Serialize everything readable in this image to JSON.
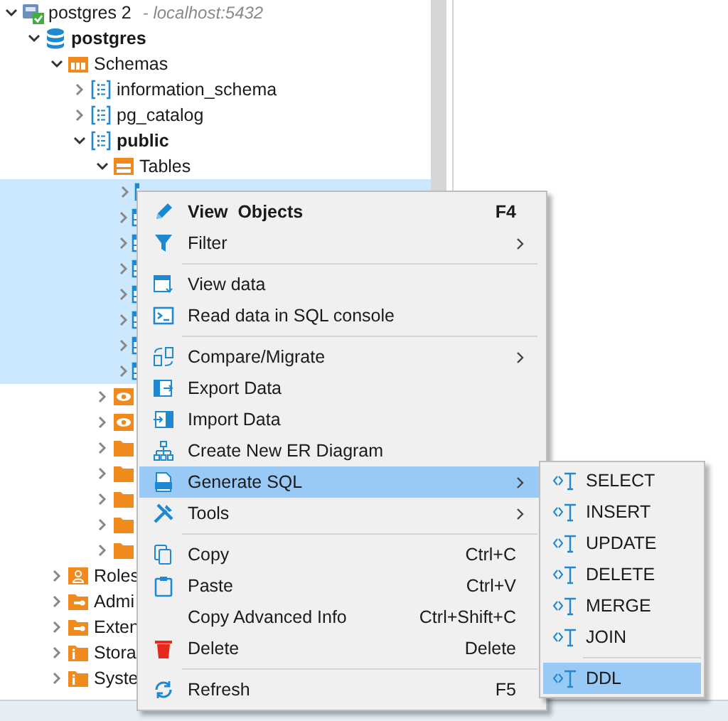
{
  "tree": [
    {
      "kind": "connection",
      "label": "postgres 2",
      "suffix": "- localhost:5432",
      "expanded": true,
      "children": [
        {
          "kind": "database",
          "label": "postgres",
          "bold": true,
          "expanded": true,
          "children": [
            {
              "kind": "schemas",
              "label": "Schemas",
              "expanded": true,
              "children": [
                {
                  "kind": "schema",
                  "label": "information_schema",
                  "expanded": false
                },
                {
                  "kind": "schema",
                  "label": "pg_catalog",
                  "expanded": false
                },
                {
                  "kind": "schema",
                  "label": "public",
                  "bold": true,
                  "expanded": true,
                  "children": [
                    {
                      "kind": "tables",
                      "label": "Tables",
                      "expanded": true,
                      "children": [
                        {
                          "kind": "table",
                          "expanded": false,
                          "selected": true
                        },
                        {
                          "kind": "table",
                          "expanded": false,
                          "selected": true
                        },
                        {
                          "kind": "table",
                          "expanded": false,
                          "selected": true
                        },
                        {
                          "kind": "table",
                          "expanded": false,
                          "selected": true
                        },
                        {
                          "kind": "table",
                          "expanded": false,
                          "selected": true
                        },
                        {
                          "kind": "table",
                          "expanded": false,
                          "selected": true
                        },
                        {
                          "kind": "table",
                          "expanded": false,
                          "selected": true
                        },
                        {
                          "kind": "table",
                          "expanded": false,
                          "selected": true
                        }
                      ]
                    },
                    {
                      "kind": "view",
                      "expanded": false
                    },
                    {
                      "kind": "view",
                      "expanded": false
                    },
                    {
                      "kind": "folder",
                      "expanded": false
                    },
                    {
                      "kind": "folder",
                      "expanded": false
                    },
                    {
                      "kind": "folder",
                      "expanded": false
                    },
                    {
                      "kind": "folder",
                      "expanded": false
                    },
                    {
                      "kind": "folder",
                      "expanded": false
                    }
                  ]
                }
              ]
            },
            {
              "kind": "roles",
              "label": "Roles",
              "expanded": false
            },
            {
              "kind": "admin",
              "label": "Admi",
              "expanded": false
            },
            {
              "kind": "admin",
              "label": "Exten",
              "expanded": false
            },
            {
              "kind": "info",
              "label": "Stora",
              "expanded": false
            },
            {
              "kind": "info",
              "label": "Syste",
              "expanded": false
            }
          ]
        }
      ]
    }
  ],
  "context_menu": [
    {
      "kind": "item",
      "label": "View  Objects",
      "bold": true,
      "shortcut": "F4",
      "selected": false
    },
    {
      "kind": "item",
      "label": "Filter",
      "submenu": true,
      "selected": false
    },
    {
      "kind": "separator"
    },
    {
      "kind": "item",
      "label": "View data",
      "selected": false
    },
    {
      "kind": "item",
      "label": "Read data in SQL console",
      "selected": false
    },
    {
      "kind": "separator"
    },
    {
      "kind": "item",
      "label": "Compare/Migrate",
      "submenu": true,
      "selected": false
    },
    {
      "kind": "item",
      "label": "Export Data",
      "selected": false
    },
    {
      "kind": "item",
      "label": "Import Data",
      "selected": false
    },
    {
      "kind": "item",
      "label": "Create New ER Diagram",
      "selected": false
    },
    {
      "kind": "item",
      "label": "Generate SQL",
      "submenu": true,
      "selected": true
    },
    {
      "kind": "item",
      "label": "Tools",
      "submenu": true,
      "selected": false
    },
    {
      "kind": "separator"
    },
    {
      "kind": "item",
      "label": "Copy",
      "shortcut": "Ctrl+C",
      "selected": false
    },
    {
      "kind": "item",
      "label": "Paste",
      "shortcut": "Ctrl+V",
      "selected": false
    },
    {
      "kind": "item",
      "label": "Copy Advanced Info",
      "shortcut": "Ctrl+Shift+C",
      "selected": false
    },
    {
      "kind": "item",
      "label": "Delete",
      "shortcut": "Delete",
      "selected": false
    },
    {
      "kind": "separator"
    },
    {
      "kind": "item",
      "label": "Refresh",
      "shortcut": "F5",
      "selected": false
    }
  ],
  "submenu": [
    {
      "kind": "item",
      "label": "SELECT",
      "selected": false
    },
    {
      "kind": "item",
      "label": "INSERT",
      "selected": false
    },
    {
      "kind": "item",
      "label": "UPDATE",
      "selected": false
    },
    {
      "kind": "item",
      "label": "DELETE",
      "selected": false
    },
    {
      "kind": "item",
      "label": "MERGE",
      "selected": false
    },
    {
      "kind": "item",
      "label": "JOIN",
      "selected": false
    },
    {
      "kind": "separator"
    },
    {
      "kind": "item",
      "label": "DDL",
      "selected": true
    }
  ]
}
